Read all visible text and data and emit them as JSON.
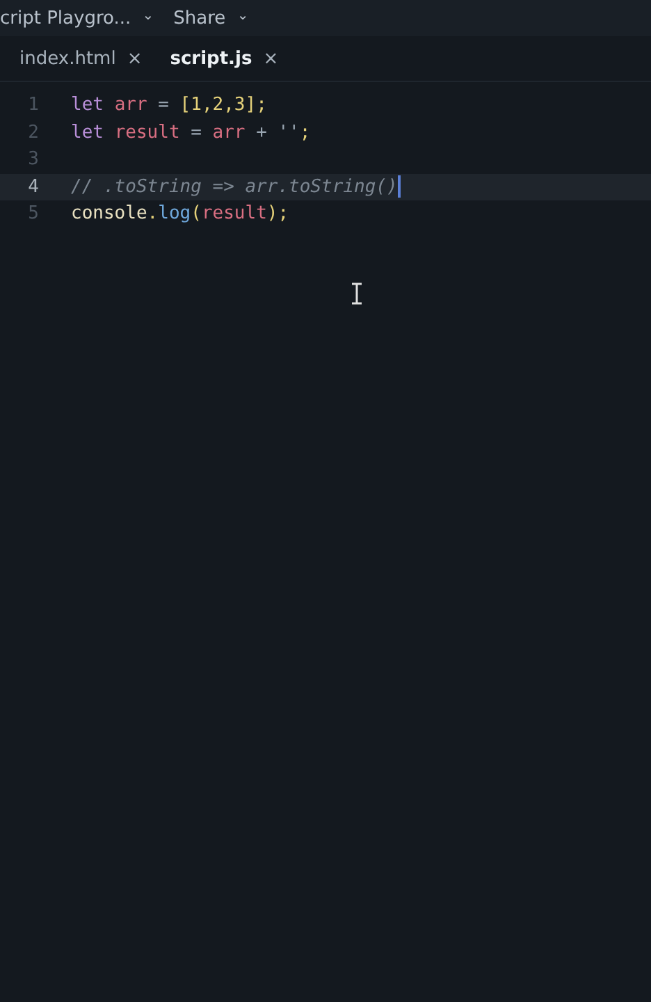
{
  "header": {
    "project": {
      "label": "cript Playgro...",
      "caret": "⌄"
    },
    "share": {
      "label": "Share",
      "caret": "⌄"
    }
  },
  "tabs": [
    {
      "label": "index.html",
      "close": "×",
      "selected": false
    },
    {
      "label": "script.js",
      "close": "×",
      "selected": true
    }
  ],
  "editor": {
    "lines": [
      {
        "number": "1",
        "current": false,
        "tokens": [
          {
            "kind": "keyword",
            "text": "let "
          },
          {
            "kind": "variable",
            "text": "arr"
          },
          {
            "kind": "operator",
            "text": " = "
          },
          {
            "kind": "punct",
            "text": "["
          },
          {
            "kind": "number",
            "text": "1"
          },
          {
            "kind": "punct",
            "text": ","
          },
          {
            "kind": "number",
            "text": "2"
          },
          {
            "kind": "punct",
            "text": ","
          },
          {
            "kind": "number",
            "text": "3"
          },
          {
            "kind": "punct",
            "text": "];"
          }
        ]
      },
      {
        "number": "2",
        "current": false,
        "tokens": [
          {
            "kind": "keyword",
            "text": "let "
          },
          {
            "kind": "variable",
            "text": "result"
          },
          {
            "kind": "operator",
            "text": " = "
          },
          {
            "kind": "variable",
            "text": "arr"
          },
          {
            "kind": "operator",
            "text": " + "
          },
          {
            "kind": "string",
            "text": "''"
          },
          {
            "kind": "punct",
            "text": ";"
          }
        ]
      },
      {
        "number": "3",
        "current": false
      },
      {
        "number": "4",
        "current": true,
        "tokens": [
          {
            "kind": "comment",
            "text": "// .toString => arr.toString()"
          }
        ]
      },
      {
        "number": "5",
        "current": false,
        "tokens": [
          {
            "kind": "object",
            "text": "console"
          },
          {
            "kind": "punct",
            "text": "."
          },
          {
            "kind": "method",
            "text": "log"
          },
          {
            "kind": "punct",
            "text": "("
          },
          {
            "kind": "variable",
            "text": "result"
          },
          {
            "kind": "punct",
            "text": ");"
          }
        ]
      }
    ]
  }
}
